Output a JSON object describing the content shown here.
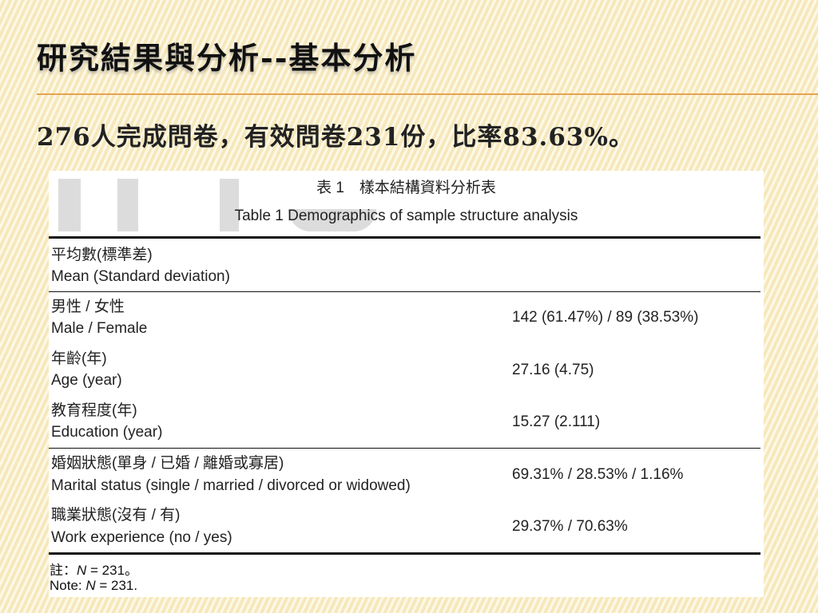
{
  "slide": {
    "title": "研究結果與分析--基本分析",
    "subtitle": "276人完成問卷，有效問卷231份，比率83.63%。"
  },
  "table": {
    "caption_zh": "表 1　樣本結構資料分析表",
    "caption_en": "Table 1   Demographics of sample structure analysis",
    "header": {
      "label_zh": "平均數(標準差)",
      "label_en": "Mean (Standard deviation)"
    },
    "rows": [
      {
        "label_zh": "男性 / 女性",
        "label_en": "Male / Female",
        "value": "142 (61.47%) / 89 (38.53%)"
      },
      {
        "label_zh": "年齡(年)",
        "label_en": "Age (year)",
        "value": "27.16 (4.75)"
      },
      {
        "label_zh": "教育程度(年)",
        "label_en": "Education (year)",
        "value": "15.27 (2.111)"
      },
      {
        "label_zh": "婚姻狀態(單身 / 已婚 / 離婚或寡居)",
        "label_en": "Marital status (single / married / divorced or widowed)",
        "value": "69.31% / 28.53% / 1.16%"
      },
      {
        "label_zh": "職業狀態(沒有 / 有)",
        "label_en": "Work experience (no / yes)",
        "value": "29.37% / 70.63%"
      }
    ],
    "note_zh": {
      "prefix": "註：",
      "var": "N",
      "rest": " = 231。"
    },
    "note_en": {
      "prefix": "Note: ",
      "var": "N",
      "rest": " = 231."
    }
  }
}
